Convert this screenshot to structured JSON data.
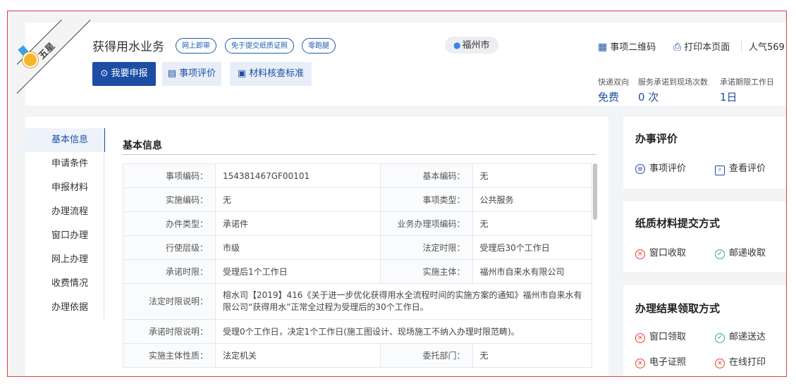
{
  "header": {
    "badge": "五星",
    "title": "获得用水业务",
    "tags": [
      "网上即审",
      "免于提交纸质证照",
      "零跑腿"
    ],
    "city": "福州市",
    "apply_button": "我要申报",
    "eval_button": "事项评价",
    "standard_button": "材料核查标准",
    "qrcode_label": "事项二维码",
    "print_label": "打印本页面",
    "popularity_label": "人气569",
    "stats": {
      "labels": [
        "快递双向",
        "服务承诺到现场次数",
        "承诺期限工作日"
      ],
      "values": [
        "免费",
        "0 次",
        "1日"
      ]
    }
  },
  "sidenav": {
    "items": [
      "基本信息",
      "申请条件",
      "申报材料",
      "办理流程",
      "窗口办理",
      "网上办理",
      "收费情况",
      "办理依据"
    ]
  },
  "basic_info": {
    "title": "基本信息",
    "rows": [
      {
        "l1": "事项编码：",
        "v1": "154381467GF00101",
        "l2": "基本编码：",
        "v2": "无"
      },
      {
        "l1": "实施编码：",
        "v1": "无",
        "l2": "事项类型：",
        "v2": "公共服务"
      },
      {
        "l1": "办件类型：",
        "v1": "承诺件",
        "l2": "业务办理项编码：",
        "v2": "无"
      },
      {
        "l1": "行使层级：",
        "v1": "市级",
        "l2": "法定时限：",
        "v2": "受理后30个工作日"
      },
      {
        "l1": "承诺时限：",
        "v1": "受理后1个工作日",
        "l2": "实施主体：",
        "v2": "福州市自来水有限公司"
      }
    ],
    "legal_note_label": "法定时限说明：",
    "legal_note": "榕水司【2019】416《关于进一步优化获得用水全流程时间的实施方案的通知》福州市自来水有限公司“获得用水”正常全过程为受理后的30个工作日。",
    "promise_note_label": "承诺时限说明：",
    "promise_note": "受理0个工作日，决定1个工作日(施工图设计、现场施工不纳入办理时限范畴)。",
    "last_row": {
      "l1": "实施主体性质：",
      "v1": "法定机关",
      "l2": "委托部门：",
      "v2": "无"
    }
  },
  "cards": {
    "evaluation": {
      "title": "办事评价",
      "item1": "事项评价",
      "item2": "查看评价"
    },
    "paper": {
      "title": "纸质材料提交方式",
      "item1": "窗口收取",
      "item2": "邮递收取"
    },
    "result": {
      "title": "办理结果领取方式",
      "item1": "窗口领取",
      "item2": "邮递送达",
      "item3": "电子证照",
      "item4": "在线打印"
    }
  }
}
